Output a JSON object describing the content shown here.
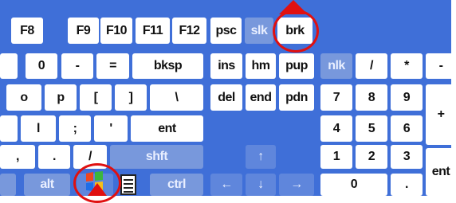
{
  "keyboard": {
    "row_fn": [
      "F8",
      "F9",
      "F10",
      "F11",
      "F12",
      "psc",
      "slk",
      "brk"
    ],
    "row_num": [
      "0",
      "-",
      "=",
      "bksp",
      "ins",
      "hm",
      "pup",
      "nlk",
      "/",
      "*",
      "-"
    ],
    "row_top": [
      "o",
      "p",
      "[",
      "]",
      "\\",
      "del",
      "end",
      "pdn",
      "7",
      "8",
      "9",
      "+"
    ],
    "row_home": [
      "l",
      ";",
      "'",
      "ent",
      "4",
      "5",
      "6"
    ],
    "row_bottom": [
      ",",
      ".",
      "/",
      "shft",
      "1",
      "2",
      "3",
      "ent"
    ],
    "row_space": [
      "alt",
      "ctrl",
      "0",
      "."
    ],
    "arrows": [
      "↑",
      "←",
      "↓",
      "→"
    ]
  },
  "colors": {
    "panel": "#3f6fd8",
    "key": "#ffffff",
    "modifier_key": "#7898dc",
    "highlight_ring": "#e01010",
    "pointer": "#e01010"
  },
  "icons": [
    "windows-logo-icon",
    "context-menu-icon",
    "mouse-pointer-icon"
  ]
}
